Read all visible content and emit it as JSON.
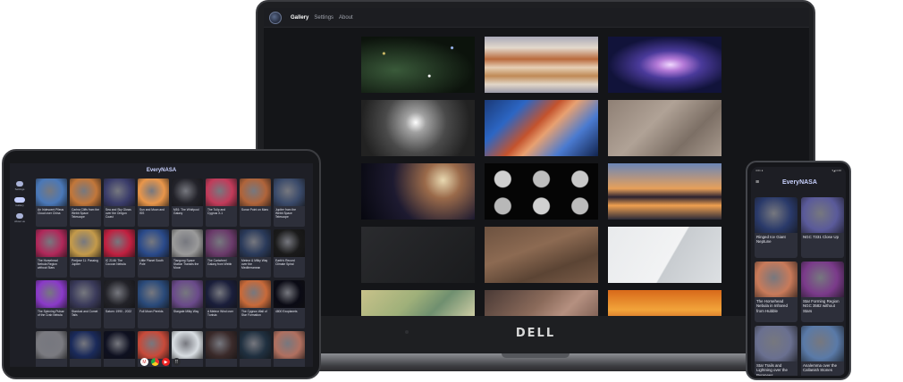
{
  "laptop": {
    "nav": {
      "tabs": [
        "Gallery",
        "Settings",
        "About"
      ],
      "active_tab": "Gallery"
    },
    "brand": "DELL",
    "tiles": [
      "stars-deep-field",
      "jupiter-bands",
      "spiral-galaxy",
      "grey-star-cluster",
      "nebula-cloud",
      "rocky-surface",
      "deep-space-galaxy",
      "lunar-phases",
      "sunset-collage",
      "dark-panel",
      "mars-terrain",
      "white-panel",
      "earth-coastline",
      "dust-cloud",
      "orange-horizon"
    ]
  },
  "tablet": {
    "title": "EveryNASA",
    "rail": [
      "Settings",
      "Gallery",
      "About us"
    ],
    "cards": [
      {
        "text": "An Iridescent Pileus Cloud over China",
        "swatch": "#4a78b8"
      },
      {
        "text": "Carina Cliffs from the Webb Space Telescope",
        "swatch": "#c2773a"
      },
      {
        "text": "Sea and Sky Glows over the Oregon Coast",
        "swatch": "#3a3c6a"
      },
      {
        "text": "Sun and Moon and ISS",
        "swatch": "#e9964a"
      },
      {
        "text": "M51: The Whirlpool Galaxy",
        "swatch": "#23232a"
      },
      {
        "text": "The Tulip and Cygnus X-1",
        "swatch": "#c23b5a"
      },
      {
        "text": "Sonar Point on Mars",
        "swatch": "#b0643a"
      },
      {
        "text": "Jupiter from the Webb Space Telescope",
        "swatch": "#3a4a6a"
      },
      {
        "text": "The Horsehead Nebula Region without Stars",
        "swatch": "#b0285a"
      },
      {
        "text": "Perijove 11: Passing Jupiter",
        "swatch": "#c49a4a"
      },
      {
        "text": "IC 2146: The Cocoon Nebula",
        "swatch": "#c02040"
      },
      {
        "text": "Little Planet South Pole",
        "swatch": "#2a4a8a"
      },
      {
        "text": "Tiangong Space Station Transits the Moon",
        "swatch": "#9a9a9a"
      },
      {
        "text": "The Cartwheel Galaxy from Webb",
        "swatch": "#6a3a6a"
      },
      {
        "text": "Meteor & Milky Way over the Mediterranean",
        "swatch": "#2a3a5a"
      },
      {
        "text": "Earth's Record Climate Spiral",
        "swatch": "#1a1a1a"
      },
      {
        "text": "The Spinning Pulsar of the Crab Nebula",
        "swatch": "#8a3ac8"
      },
      {
        "text": "Stardust and Comet Tails",
        "swatch": "#3a3a5a"
      },
      {
        "text": "Saturn: 1990 - 2022",
        "swatch": "#222228"
      },
      {
        "text": "Full Moon Pereids",
        "swatch": "#2a4a7a"
      },
      {
        "text": "Stargate Milky Way",
        "swatch": "#6a4a8a"
      },
      {
        "text": "A Meteor Wind over Tunisia",
        "swatch": "#1a1e3a"
      },
      {
        "text": "The Cygnus Wall of Star Formation",
        "swatch": "#c86a3a"
      },
      {
        "text": "4800 Exoplanets",
        "swatch": "#0a0a14"
      },
      {
        "text": "",
        "swatch": "#7a7a80"
      },
      {
        "text": "",
        "swatch": "#1a2a5a"
      },
      {
        "text": "",
        "swatch": "#0e1020"
      },
      {
        "text": "",
        "swatch": "#c84a3a"
      },
      {
        "text": "",
        "swatch": "#d8dde2"
      },
      {
        "text": "",
        "swatch": "#3a2a2a"
      },
      {
        "text": "",
        "swatch": "#203040"
      },
      {
        "text": "",
        "swatch": "#b07060"
      }
    ]
  },
  "phone": {
    "title": "EveryNASA",
    "status_left": "4:01 ●",
    "status_right": "▾◢ 4:40",
    "cards": [
      {
        "text": "Ringed Ice Giant Neptune",
        "swatch": "#2a3a6a"
      },
      {
        "text": "NGC 7331 Close Up",
        "swatch": "#5a5a9a"
      },
      {
        "text": "The Horsehead Nebula in Infrared from Hubble",
        "swatch": "#c87a5a"
      },
      {
        "text": "Star Forming Region NGC 3582 without Stars",
        "swatch": "#7a3a8a"
      },
      {
        "text": "Star Trails and Lightning over the Pyrenees",
        "swatch": "#6a7090"
      },
      {
        "text": "Analemma over the Callanish Stones",
        "swatch": "#5a7aa8"
      }
    ]
  }
}
